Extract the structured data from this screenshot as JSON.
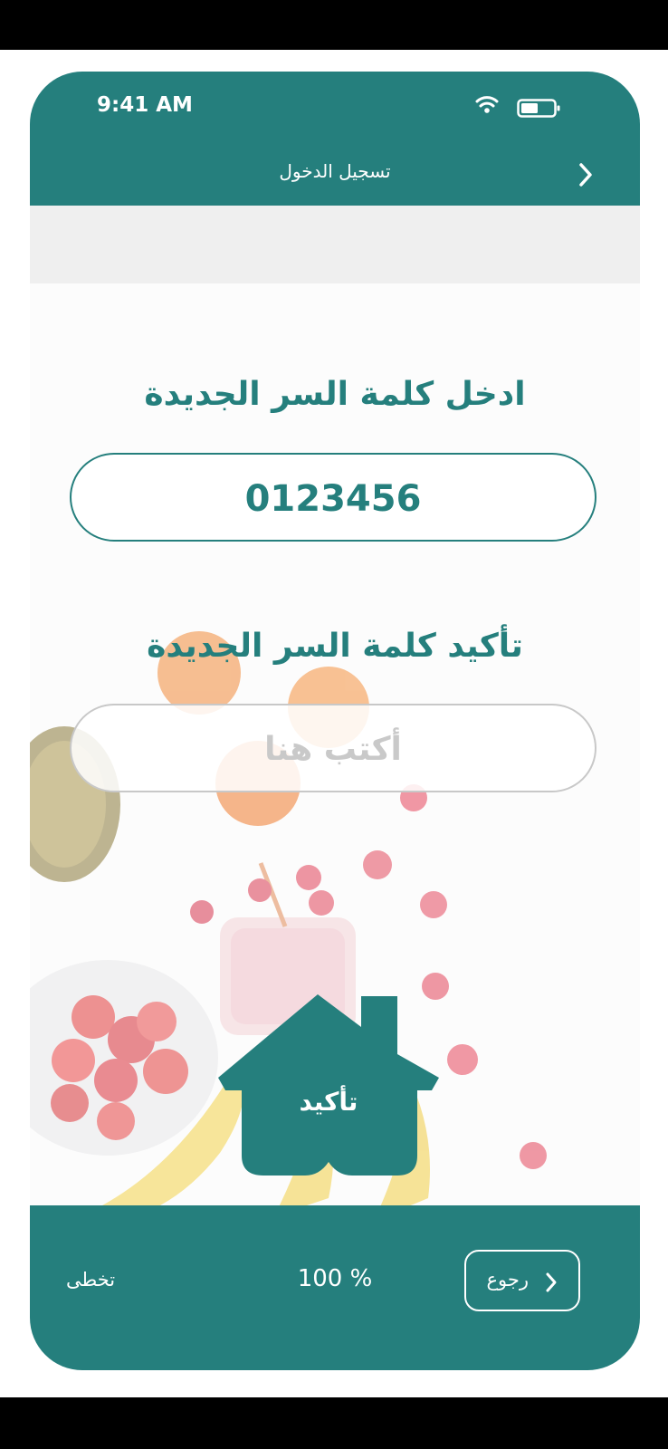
{
  "status_bar": {
    "time": "9:41 AM"
  },
  "header": {
    "title": "تسجيل الدخول"
  },
  "form": {
    "new_password_label": "ادخل كلمة السر الجديدة",
    "new_password_value": "0123456",
    "confirm_label": "تأكيد كلمة السر الجديدة",
    "confirm_placeholder": "أكتب هنا",
    "confirm_button": "تأكيد"
  },
  "footer": {
    "skip_label": "تخطى",
    "progress_text": "100 %",
    "progress_percent": 100,
    "back_label": "رجوع"
  },
  "colors": {
    "brand": "#257f7d",
    "strip": "#efefef"
  },
  "icons": [
    "wifi-icon",
    "battery-icon",
    "chevron-right-icon",
    "house-shape"
  ]
}
